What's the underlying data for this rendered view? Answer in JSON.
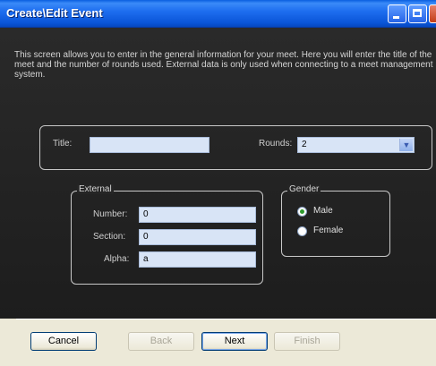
{
  "window": {
    "title": "Create\\Edit Event"
  },
  "intro_text": "This screen allows you to enter in the general information for your meet. Here you will enter the title of the meet and the number of rounds used. External data is only used when connecting to a meet management system.",
  "top_group": {
    "title_label": "Title:",
    "title_value": "",
    "rounds_label": "Rounds:",
    "rounds_value": "2"
  },
  "external": {
    "legend": "External",
    "number_label": "Number:",
    "number_value": "0",
    "section_label": "Section:",
    "section_value": "0",
    "alpha_label": "Alpha:",
    "alpha_value": "a"
  },
  "gender": {
    "legend": "Gender",
    "options": [
      {
        "label": "Male",
        "selected": true
      },
      {
        "label": "Female",
        "selected": false
      }
    ]
  },
  "buttons": {
    "cancel": "Cancel",
    "back": "Back",
    "next": "Next",
    "finish": "Finish"
  },
  "colors": {
    "titlebar": "#0a5fe0",
    "content_bg": "#252525",
    "input_bg": "#d8e4f6",
    "footer_bg": "#ece9d8"
  },
  "icons": [
    "minimize-icon",
    "maximize-icon",
    "close-icon",
    "chevron-down-icon"
  ]
}
